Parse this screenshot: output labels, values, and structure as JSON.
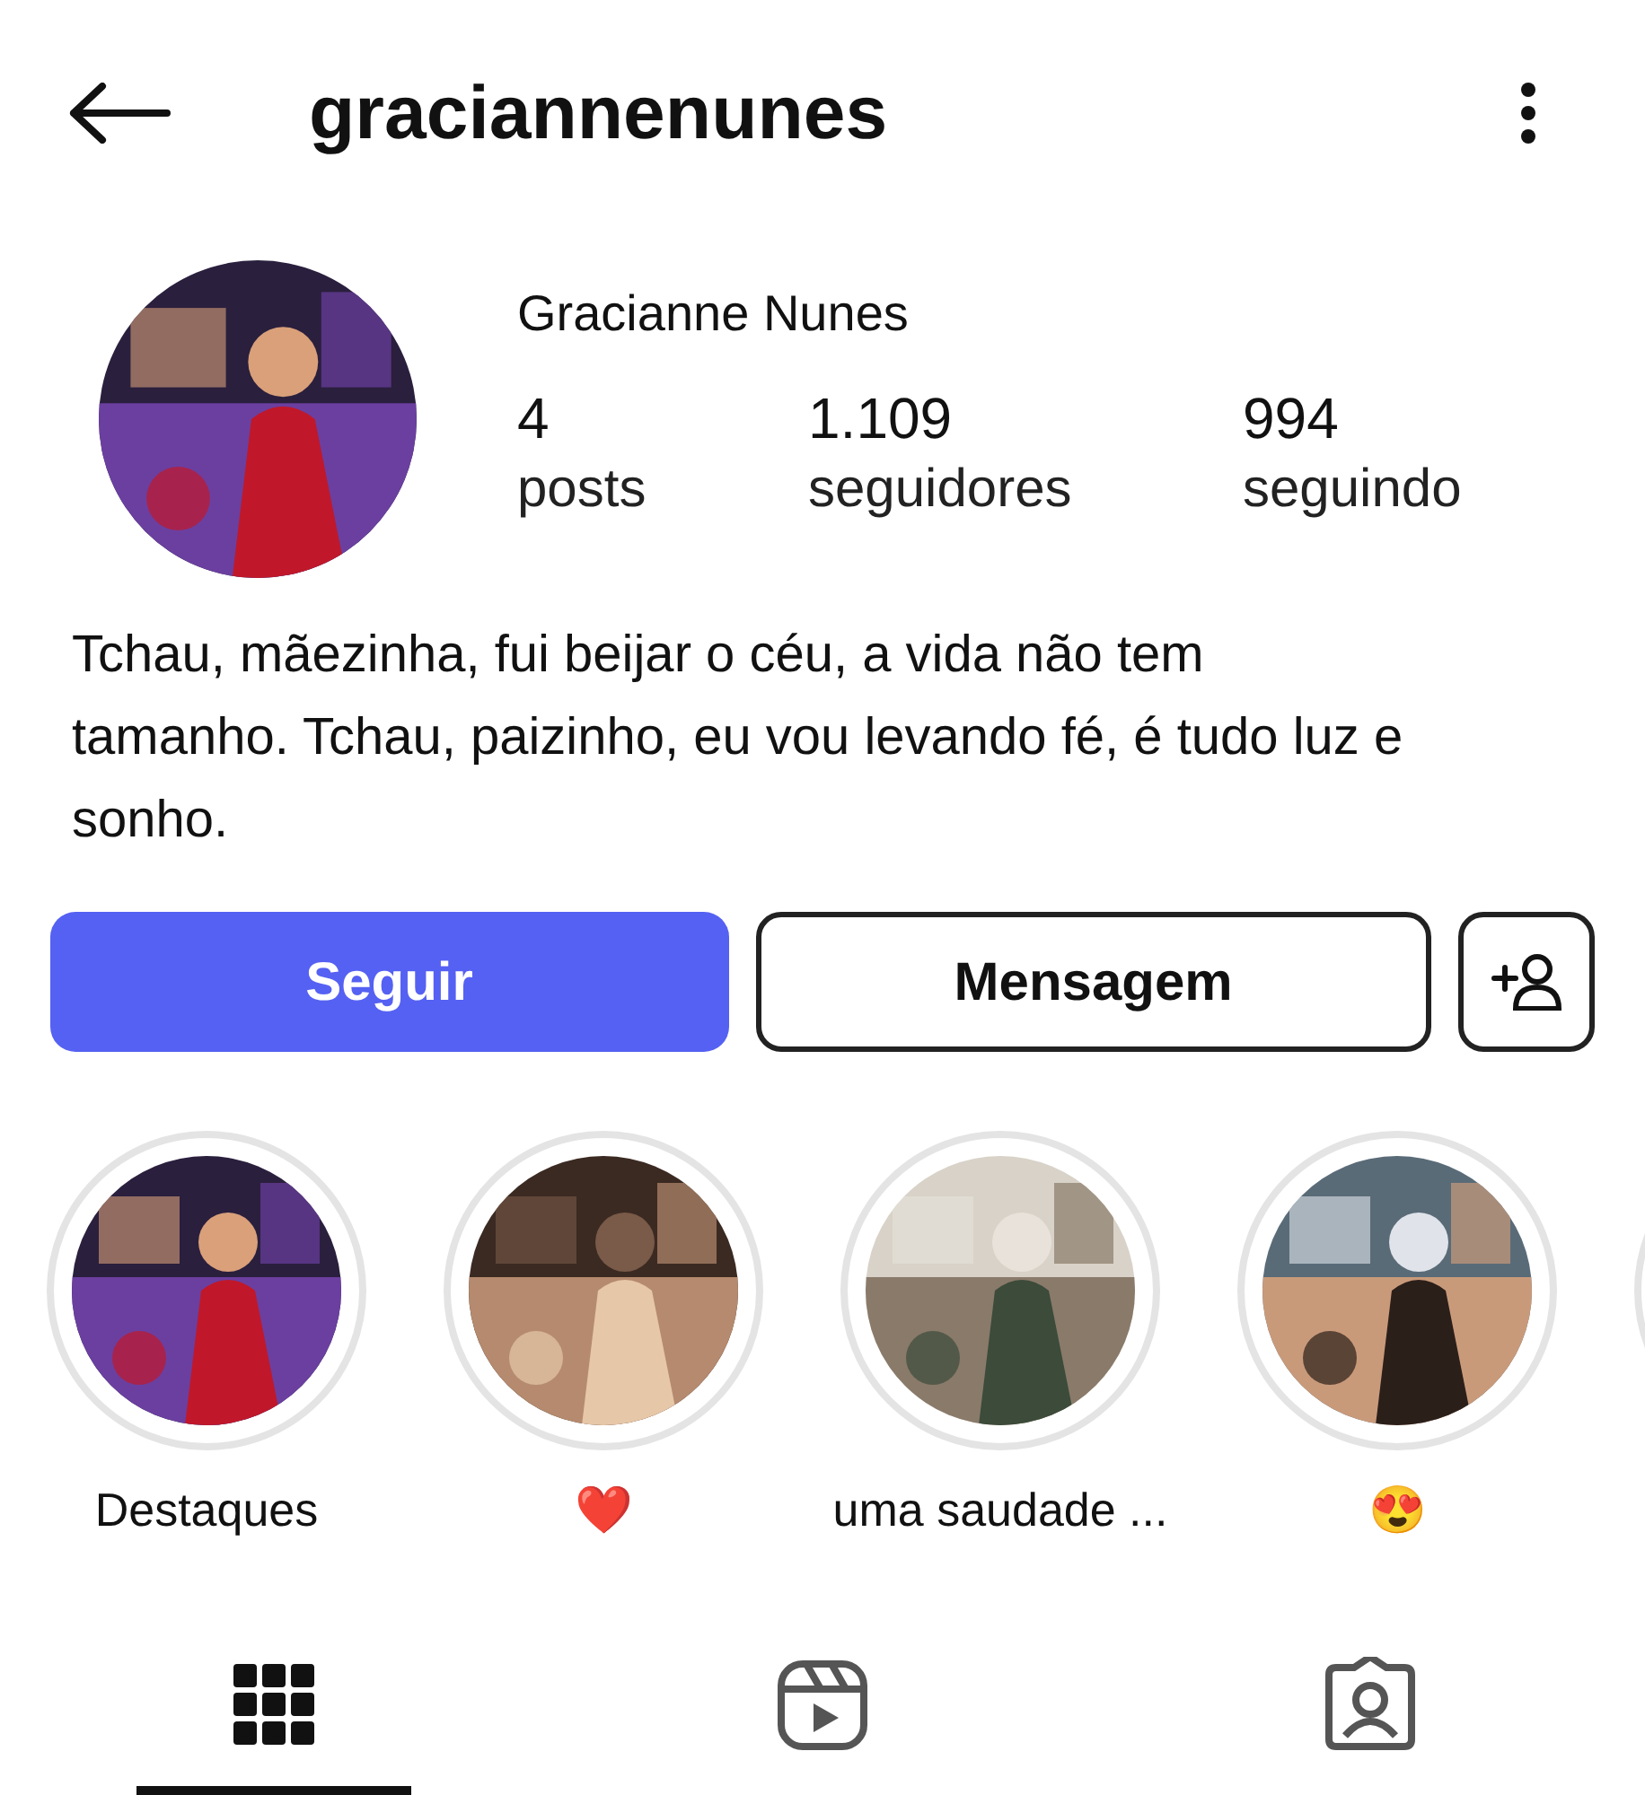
{
  "header": {
    "username": "graciannenunes"
  },
  "profile": {
    "name": "Gracianne Nunes",
    "stats": [
      {
        "value": "4",
        "label": "posts"
      },
      {
        "value": "1.109",
        "label": "seguidores"
      },
      {
        "value": "994",
        "label": "seguindo"
      }
    ],
    "bio": "Tchau, mãezinha, fui beijar o céu, a vida não tem tamanho. Tchau, paizinho, eu vou levando fé, é tudo luz e sonho."
  },
  "actions": {
    "follow": "Seguir",
    "message": "Mensagem"
  },
  "highlights": [
    {
      "label": "Destaques"
    },
    {
      "label": "❤️"
    },
    {
      "label": "uma saudade ..."
    },
    {
      "label": "😍"
    }
  ],
  "tabs": [
    {
      "kind": "grid",
      "selected": true
    },
    {
      "kind": "reels",
      "selected": false
    },
    {
      "kind": "tagged",
      "selected": false
    }
  ]
}
